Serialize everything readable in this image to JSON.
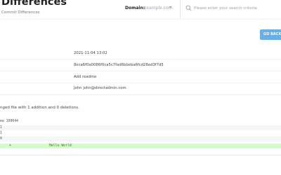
{
  "header": {
    "title": "Differences",
    "subtitle": "Commit Differences",
    "domain_label": "Domain:",
    "domain_value": "example.com",
    "search_placeholder": "Please enter your search criteria"
  },
  "actions": {
    "back_label": "GO BACK"
  },
  "commit": {
    "date": "2021-11-04 13:02",
    "hash": "8eca6f0a0086f0ca5c7fad6bbeba6fcd28ed3f7d5",
    "message": "Add readme",
    "author": "John john@directadmin.com"
  },
  "summary": "nged file with 1 addition and 0 deletions.",
  "diff": {
    "header": "ew 100644",
    "lines": [
      {
        "num": "1",
        "marker": "",
        "code": "",
        "type": "context"
      },
      {
        "num": "1",
        "marker": "",
        "code": "",
        "type": "context"
      },
      {
        "num": "0",
        "marker": "",
        "code": "",
        "type": "context"
      },
      {
        "num": "",
        "marker": "+",
        "code": "Hello World",
        "type": "added"
      }
    ]
  },
  "colors": {
    "accent": "#6aaee6",
    "added_bg": "#d4fbc9",
    "added_text": "#2f7d1e"
  },
  "icons": {
    "search": "search-icon",
    "domain_caret": "chevron-down-icon"
  }
}
